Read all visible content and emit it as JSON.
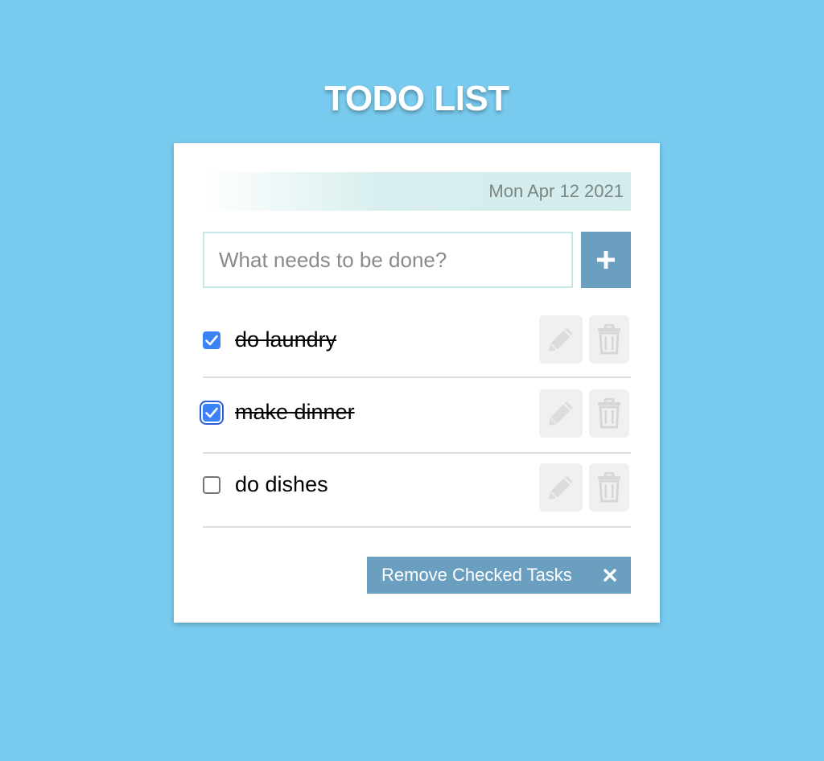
{
  "header": {
    "title": "TODO LIST"
  },
  "date": "Mon Apr 12 2021",
  "new_task": {
    "placeholder": "What needs to be done?",
    "value": "",
    "add_icon": "plus-icon"
  },
  "tasks": [
    {
      "label": "do laundry",
      "checked": true,
      "edit_icon": "pencil-icon",
      "delete_icon": "trash-icon"
    },
    {
      "label": "make dinner",
      "checked": true,
      "focused": true,
      "edit_icon": "pencil-icon",
      "delete_icon": "trash-icon"
    },
    {
      "label": "do dishes",
      "checked": false,
      "edit_icon": "pencil-icon",
      "delete_icon": "trash-icon"
    }
  ],
  "footer": {
    "remove_label": "Remove Checked Tasks",
    "remove_icon": "close-icon"
  },
  "colors": {
    "background": "#78cbee",
    "accent": "#6b9fc0",
    "checkbox": "#3b82f6",
    "date_bar": "#d3ebeb"
  }
}
